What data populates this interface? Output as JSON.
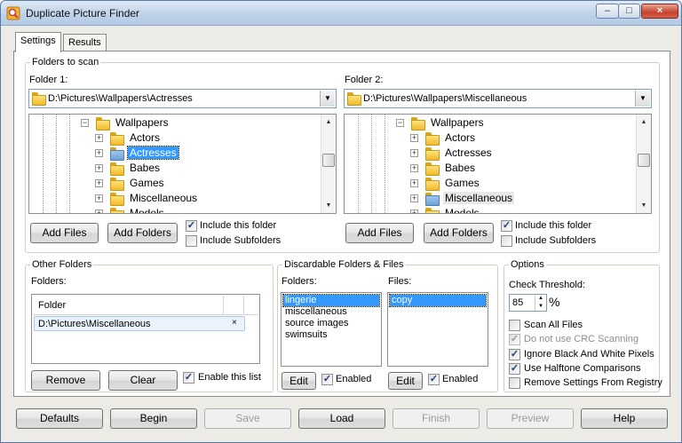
{
  "window": {
    "title": "Duplicate Picture Finder",
    "controls": [
      "–",
      "□",
      "×"
    ]
  },
  "tabs": [
    {
      "label": "Settings"
    },
    {
      "label": "Results"
    }
  ],
  "folders_to_scan": {
    "legend": "Folders to scan",
    "folder1": {
      "label": "Folder 1:",
      "path": "D:\\Pictures\\Wallpapers\\Actresses",
      "tree": {
        "parent": "Wallpapers",
        "children": [
          "Actors",
          "Actresses",
          "Babes",
          "Games",
          "Miscellaneous",
          "Models"
        ],
        "selected": "Actresses"
      },
      "add_files": "Add Files",
      "add_folders": "Add Folders",
      "include_this_folder": "Include this folder",
      "include_subfolders": "Include Subfolders"
    },
    "folder2": {
      "label": "Folder 2:",
      "path": "D:\\Pictures\\Wallpapers\\Miscellaneous",
      "tree": {
        "parent": "Wallpapers",
        "children": [
          "Actors",
          "Actresses",
          "Babes",
          "Games",
          "Miscellaneous",
          "Models"
        ],
        "selected": "Miscellaneous"
      },
      "add_files": "Add Files",
      "add_folders": "Add Folders",
      "include_this_folder": "Include this folder",
      "include_subfolders": "Include Subfolders"
    }
  },
  "other_folders": {
    "legend": "Other Folders",
    "folders_label": "Folders:",
    "column_header": "Folder",
    "rows": [
      "D:\\Pictures\\Miscellaneous"
    ],
    "row_close": "×",
    "remove": "Remove",
    "clear": "Clear",
    "enable_this_list": "Enable this list"
  },
  "discardable": {
    "legend": "Discardable Folders & Files",
    "folders_label": "Folders:",
    "files_label": "Files:",
    "folders": [
      "lingerie",
      "miscellaneous",
      "source images",
      "swimsuits"
    ],
    "files": [
      "copy"
    ],
    "edit": "Edit",
    "enabled": "Enabled"
  },
  "options": {
    "legend": "Options",
    "check_threshold_label": "Check Threshold:",
    "threshold_value": "85",
    "percent": "%",
    "items": [
      {
        "label": "Scan All Files",
        "checked": false,
        "disabled": false
      },
      {
        "label": "Do not use CRC Scanning",
        "checked": true,
        "disabled": true
      },
      {
        "label": "Ignore Black And White Pixels",
        "checked": true,
        "disabled": false
      },
      {
        "label": "Use Halftone Comparisons",
        "checked": true,
        "disabled": false
      },
      {
        "label": "Remove Settings From Registry",
        "checked": false,
        "disabled": false
      }
    ]
  },
  "bottom_buttons": [
    {
      "label": "Defaults",
      "enabled": true
    },
    {
      "label": "Begin",
      "enabled": true
    },
    {
      "label": "Save",
      "enabled": false
    },
    {
      "label": "Load",
      "enabled": true
    },
    {
      "label": "Finish",
      "enabled": false
    },
    {
      "label": "Preview",
      "enabled": false
    },
    {
      "label": "Help",
      "enabled": true
    }
  ],
  "check_glyph": "✓"
}
